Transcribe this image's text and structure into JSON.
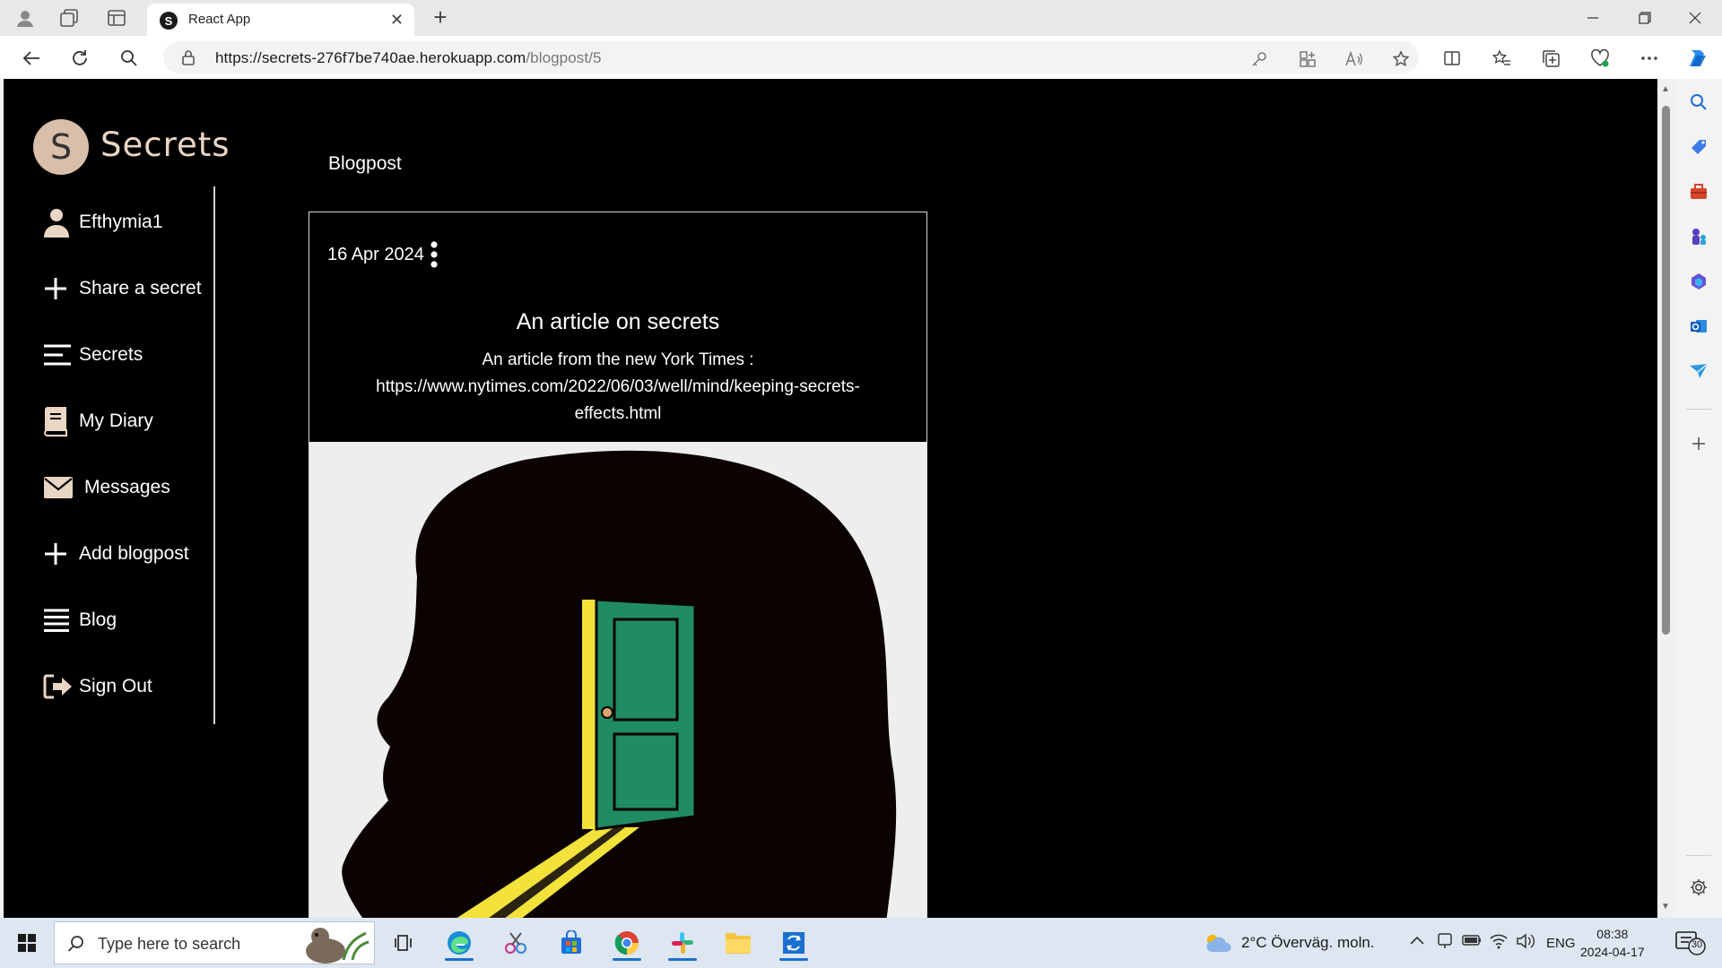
{
  "browser": {
    "tab_title": "React App",
    "tab_favicon_letter": "S",
    "url_host": "https://secrets-276f7be740ae.herokuapp.com",
    "url_path": "/blogpost/5"
  },
  "app": {
    "logo_letter": "S",
    "brand_name": "Secrets",
    "page_title": "Blogpost"
  },
  "sidebar": {
    "items": [
      {
        "label": "Efthymia1",
        "icon": "user-icon"
      },
      {
        "label": "Share a secret",
        "icon": "plus-icon"
      },
      {
        "label": "Secrets",
        "icon": "menu-lines-icon"
      },
      {
        "label": "My Diary",
        "icon": "book-icon"
      },
      {
        "label": "Messages",
        "icon": "envelope-icon"
      },
      {
        "label": "Add blogpost",
        "icon": "plus-icon"
      },
      {
        "label": "Blog",
        "icon": "list-icon"
      },
      {
        "label": "Sign Out",
        "icon": "sign-out-icon"
      }
    ]
  },
  "post": {
    "date": "16 Apr 2024",
    "title": "An article on secrets",
    "body_line1": "An article from the new York Times :",
    "body_line2": "https://www.nytimes.com/2022/06/03/well/mind/keeping-secrets-",
    "body_line3": "effects.html",
    "image_subject": "head-silhouette-with-open-door-illustration"
  },
  "taskbar": {
    "search_placeholder": "Type here to search",
    "weather": "2°C  Överväg. moln.",
    "language": "ENG",
    "time": "08:38",
    "date": "2024-04-17",
    "notifications": "30"
  },
  "colors": {
    "page_background": "#000000",
    "logo_circle": "#d9bfa9",
    "door_green": "#1f8c61",
    "light_yellow": "#f2e23a"
  }
}
